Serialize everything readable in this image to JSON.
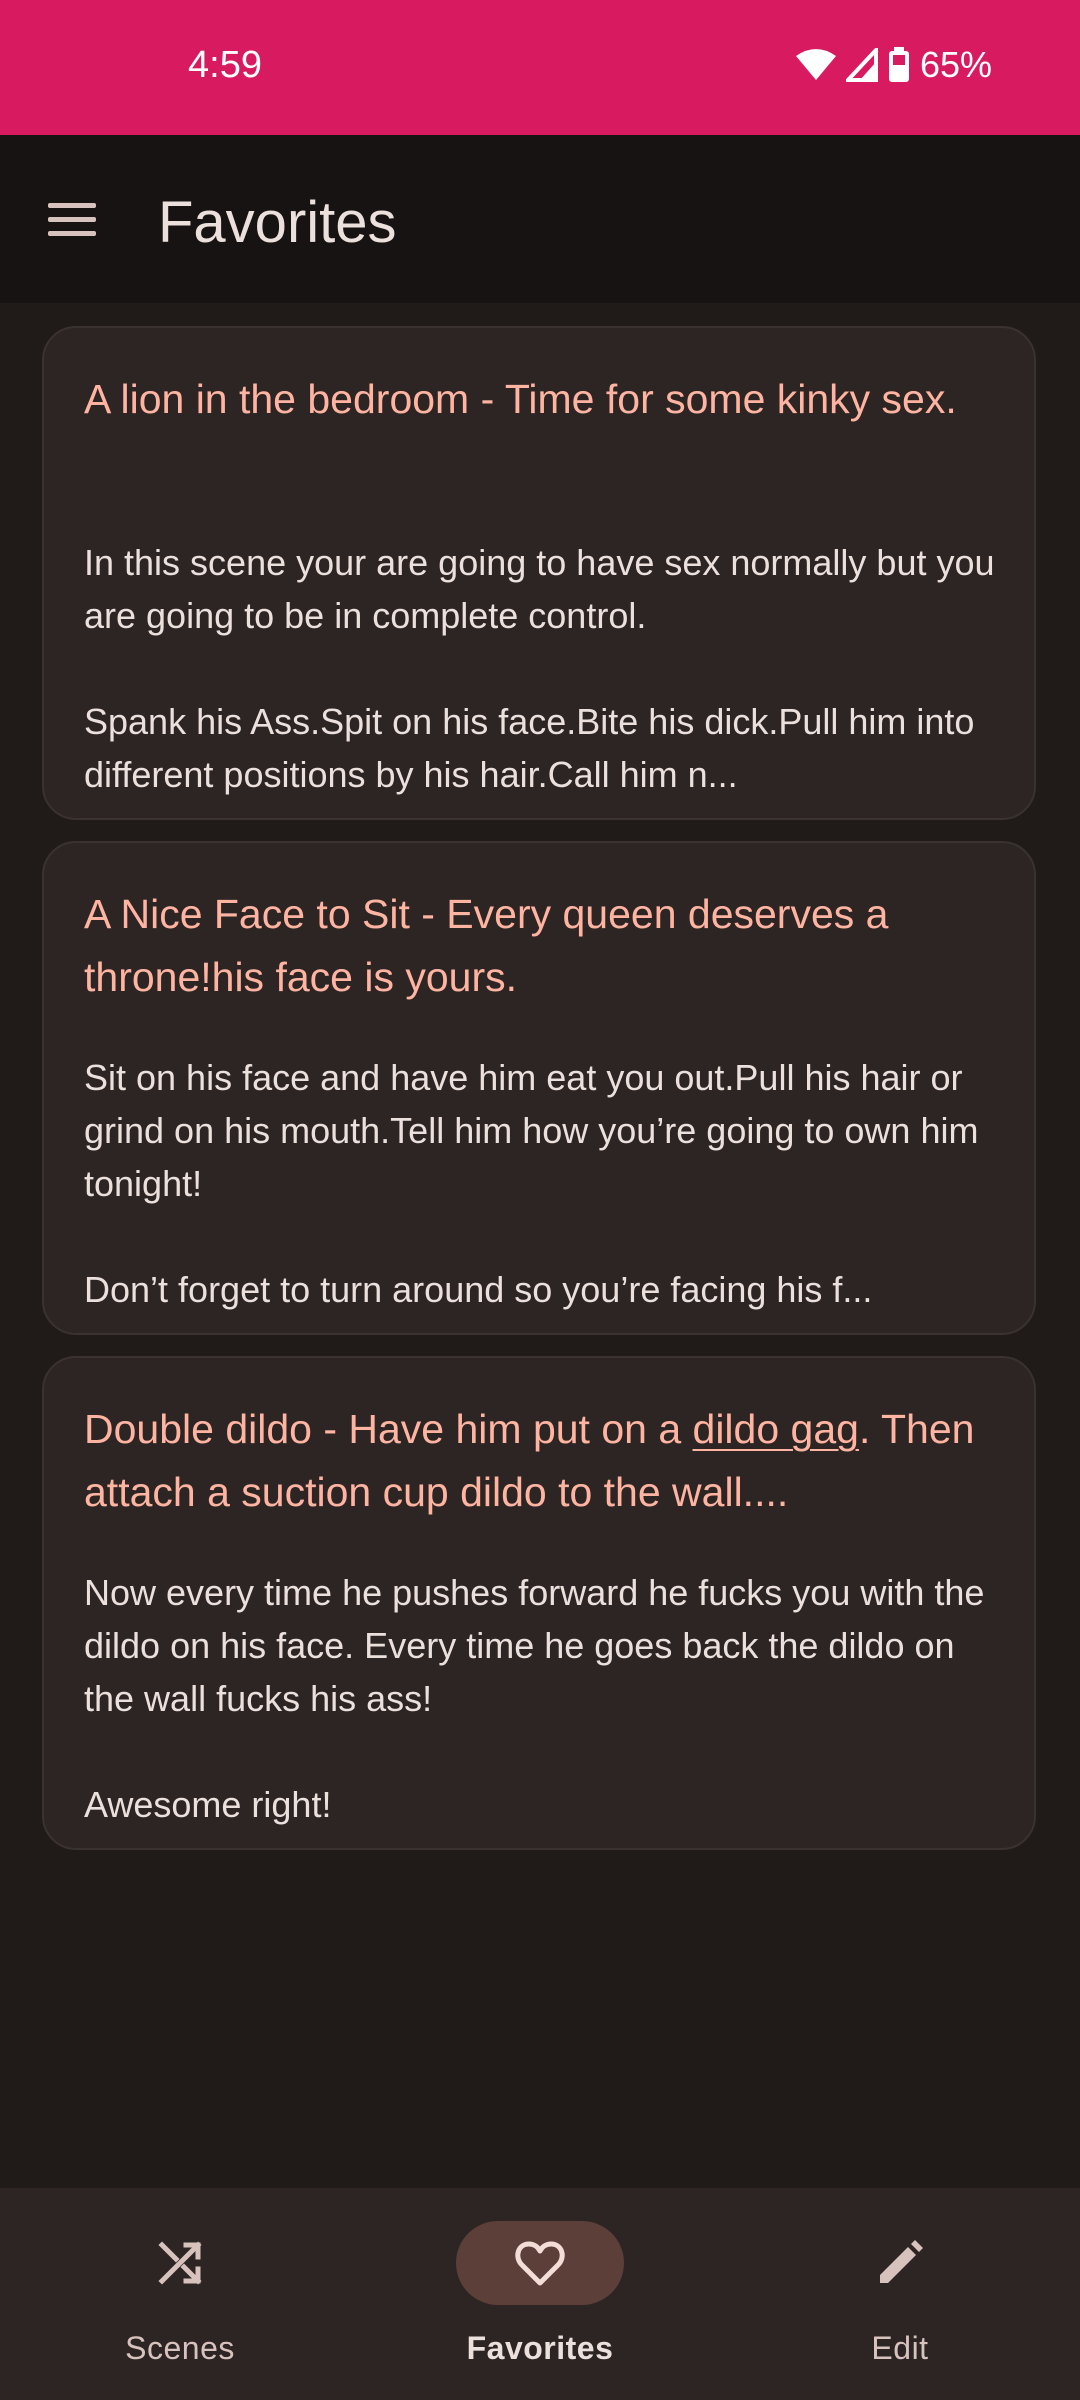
{
  "status": {
    "time": "4:59",
    "battery": "65%"
  },
  "appbar": {
    "title": "Favorites"
  },
  "cards": [
    {
      "title": "A lion in the bedroom - Time for some kinky sex.",
      "body_line1": "In this scene your are going to have sex normally but you are going to be in complete control.",
      "body_line2": "Spank his Ass.Spit on his face.Bite his dick.Pull him into different positions by his hair.Call him n..."
    },
    {
      "title": "A Nice Face to Sit - Every queen deserves a throne!his face is yours.",
      "body_line1": "Sit on his face and have him eat you out.Pull his hair or grind on his mouth.Tell him how you’re going to own him tonight!",
      "body_line2": "Don’t forget to turn around so you’re facing his f..."
    },
    {
      "title_prefix": "Double dildo - Have him put on a ",
      "title_link": "dildo gag",
      "title_suffix": ". Then attach a suction cup dildo to the wall....",
      "body_line1": "Now every time he pushes forward he fucks you with the dildo on his face. Every time he goes back the dildo on the wall fucks his ass!",
      "body_line2": "Awesome right!"
    }
  ],
  "nav": {
    "items": [
      {
        "label": "Scenes",
        "icon": "shuffle-icon"
      },
      {
        "label": "Favorites",
        "icon": "heart-icon"
      },
      {
        "label": "Edit",
        "icon": "pencil-icon"
      }
    ],
    "active": "Favorites"
  },
  "colors": {
    "status_bar": "#d81b60",
    "accent_title": "#ffb4a2",
    "card_bg": "#2c2523",
    "active_pill": "#5c3f39"
  }
}
